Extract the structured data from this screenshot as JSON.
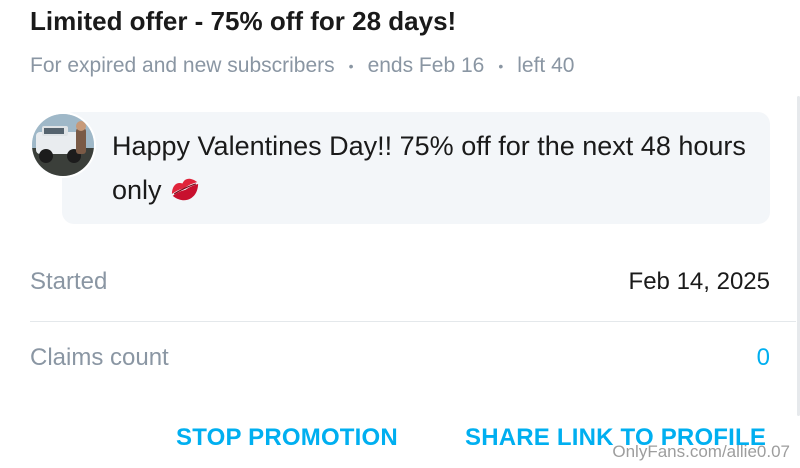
{
  "promotion": {
    "title": "Limited offer - 75% off for 28 days!",
    "meta": {
      "audience": "For expired and new subscribers",
      "ends": "ends Feb 16",
      "left": "left 40",
      "separator": "•"
    },
    "message": {
      "text": "Happy Valentines Day!! 75% off for the next 48 hours only",
      "emoji_icon": "kiss-mark-icon"
    },
    "avatar": {
      "icon": "avatar-photo"
    },
    "details": [
      {
        "label": "Started",
        "value": "Feb 14, 2025"
      },
      {
        "label": "Claims count",
        "value": "0"
      }
    ],
    "actions": {
      "stop": "STOP PROMOTION",
      "share": "SHARE LINK TO PROFILE"
    }
  },
  "watermark": "OnlyFans.com/allie0.07",
  "colors": {
    "accent": "#00aff0",
    "muted": "#8a96a3",
    "bubble": "#f3f6f9",
    "text": "#1a1a1a"
  }
}
